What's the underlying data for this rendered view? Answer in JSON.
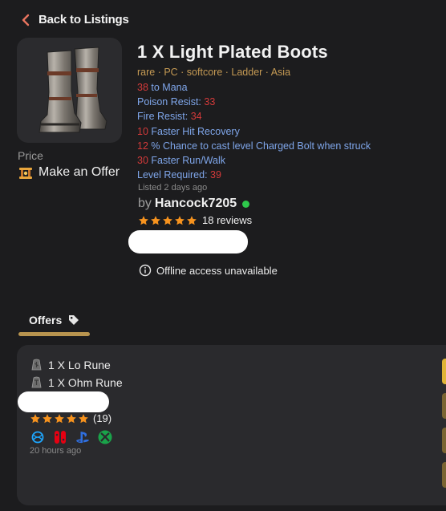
{
  "nav": {
    "back_label": "Back to Listings"
  },
  "item": {
    "title": "1 X Light Plated Boots",
    "meta": "rare · PC · softcore · Ladder · Asia",
    "stats": [
      {
        "num": "38",
        "text": " to Mana",
        "num_first": true
      },
      {
        "text": "Poison Resist: ",
        "num": "33",
        "num_first": false
      },
      {
        "text": "Fire Resist: ",
        "num": "34",
        "num_first": false
      },
      {
        "num": "10",
        "text": " Faster Hit Recovery",
        "num_first": true
      },
      {
        "num": "12",
        "text": " % Chance to cast level Charged Bolt when struck",
        "num_first": true
      },
      {
        "num": "30",
        "text": " Faster Run/Walk",
        "num_first": true
      },
      {
        "text": "Level Required: ",
        "num": "39",
        "num_first": false
      }
    ],
    "listed": "Listed 2 days ago"
  },
  "price": {
    "label": "Price",
    "value": "Make an Offer"
  },
  "seller": {
    "by": "by",
    "name": "Hancock7205",
    "rating_stars": 5,
    "reviews": "18 reviews"
  },
  "offline_notice": "Offline access unavailable",
  "offers": {
    "tab_label": "Offers",
    "list": [
      {
        "items": [
          "1 X Lo Rune",
          "1 X Ohm Rune"
        ],
        "rating_stars": 5,
        "reviews": "(19)",
        "platforms": [
          "battlenet-icon",
          "nintendo-switch-icon",
          "playstation-icon",
          "xbox-icon"
        ],
        "time": "20 hours ago"
      }
    ]
  },
  "colors": {
    "accent_gold": "#b8944f",
    "meta_gold": "#c59a54",
    "stat_blue": "#7fa6ea",
    "stat_red": "#d33a3a",
    "online_green": "#2ec84b",
    "star_orange": "#f7931e",
    "back_arrow": "#e8745f",
    "side_tab": "#b8994a"
  }
}
